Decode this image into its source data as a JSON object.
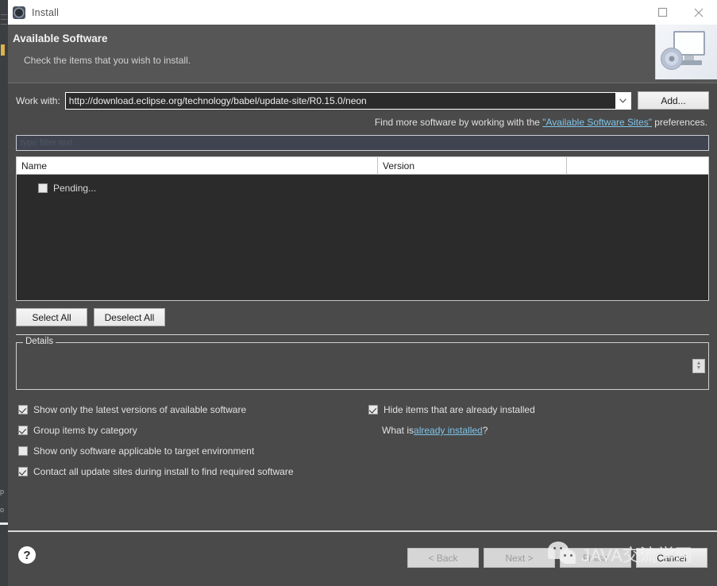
{
  "window": {
    "title": "Install",
    "icon": "install-gear-icon",
    "maximize_label": "Maximize",
    "close_label": "Close"
  },
  "banner": {
    "title": "Available Software",
    "subtitle": "Check the items that you wish to install.",
    "image_icon": "computer-disc-icon"
  },
  "work_with": {
    "label": "Work with:",
    "value": "http://download.eclipse.org/technology/babel/update-site/R0.15.0/neon",
    "dropdown_icon": "chevron-down-icon",
    "add_button": "Add..."
  },
  "find_more": {
    "prefix": "Find more software by working with the ",
    "link": "\"Available Software Sites\"",
    "suffix": " preferences."
  },
  "filter": {
    "placeholder": "type filter text",
    "value": ""
  },
  "table": {
    "columns": [
      "Name",
      "Version",
      ""
    ],
    "rows": [
      {
        "checked": false,
        "name": "Pending...",
        "version": ""
      }
    ]
  },
  "selection_buttons": {
    "select_all": "Select All",
    "deselect_all": "Deselect All"
  },
  "details": {
    "legend": "Details",
    "content": "",
    "spinner_icon": "spinner-up-down-icon"
  },
  "options": {
    "left": [
      {
        "label": "Show only the latest versions of available software",
        "checked": true
      },
      {
        "label": "Group items by category",
        "checked": true
      },
      {
        "label": "Show only software applicable to target environment",
        "checked": false
      },
      {
        "label": "Contact all update sites during install to find required software",
        "checked": true
      }
    ],
    "right": [
      {
        "label": "Hide items that are already installed",
        "checked": true
      }
    ],
    "what_is": {
      "prefix": "What is ",
      "link": "already installed",
      "suffix": "?"
    }
  },
  "footer": {
    "help_icon": "help-question-icon",
    "buttons": [
      {
        "label": "< Back",
        "enabled": false
      },
      {
        "label": "Next >",
        "enabled": false
      },
      {
        "label": "Finish",
        "enabled": false
      },
      {
        "label": "Cancel",
        "enabled": true
      }
    ]
  },
  "watermark": {
    "text": "JAVA交流学网",
    "logo_icon": "wechat-icon"
  },
  "background_window": {
    "fragment_1": "p",
    "fragment_2": "o"
  },
  "colors": {
    "dialog_bg": "#4a4a4a",
    "banner_bg": "#565656",
    "table_bg": "#2b2b2b",
    "link": "#7fc4e8",
    "titlebar_bg": "#ffffff"
  }
}
